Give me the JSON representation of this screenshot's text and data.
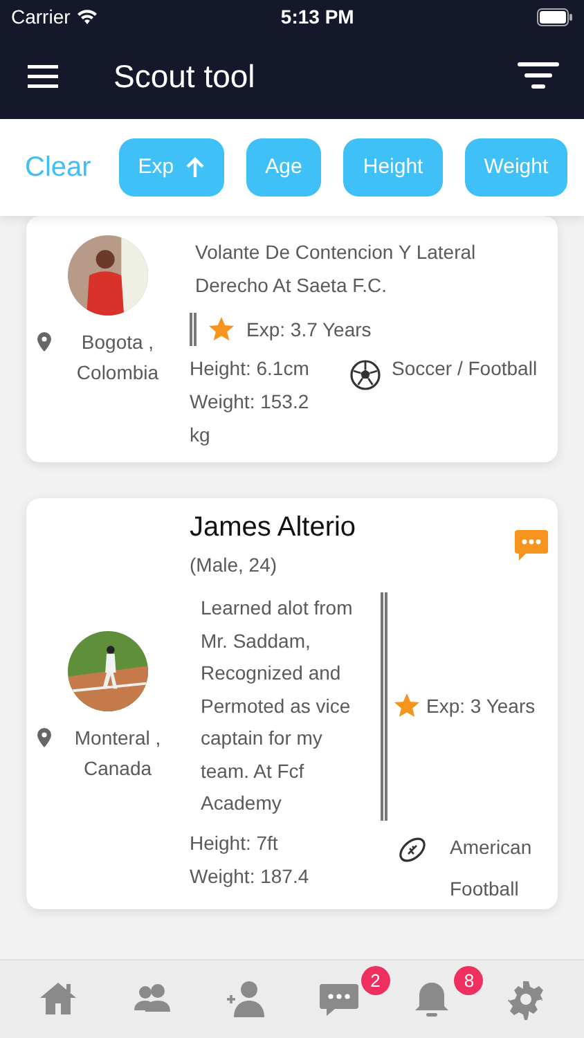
{
  "status_bar": {
    "carrier": "Carrier",
    "time": "5:13 PM"
  },
  "header": {
    "title": "Scout tool"
  },
  "filters": {
    "clear": "Clear",
    "buttons": [
      {
        "label": "Exp",
        "sorted": true
      },
      {
        "label": "Age",
        "sorted": false
      },
      {
        "label": "Height",
        "sorted": false
      },
      {
        "label": "Weight",
        "sorted": false
      }
    ]
  },
  "players": [
    {
      "kind": "wide",
      "location": "Bogota , Colombia",
      "bio": "Volante De Contencion Y Lateral Derecho At Saeta F.C.",
      "experience": "Exp: 3.7 Years",
      "height": "Height:  6.1cm",
      "weight": "Weight:  153.2 kg",
      "sport": {
        "kind": "soccer",
        "label": "Soccer / Football"
      }
    },
    {
      "kind": "split",
      "name": "James Alterio",
      "details": "(Male, 24)",
      "has_message": true,
      "location": "Monteral , Canada",
      "bio": "Learned alot from Mr. Saddam, Recognized and Permoted as vice captain for my team. At Fcf Academy",
      "experience": "Exp: 3 Years",
      "height": "Height:  7ft",
      "weight": "Weight:  187.4",
      "sport": {
        "kind": "american-football",
        "label": "American Football"
      }
    }
  ],
  "tab_bar": [
    {
      "kind": "home"
    },
    {
      "kind": "people"
    },
    {
      "kind": "add-user"
    },
    {
      "kind": "chat",
      "badge": "2"
    },
    {
      "kind": "bell",
      "badge": "8"
    },
    {
      "kind": "gear"
    }
  ]
}
